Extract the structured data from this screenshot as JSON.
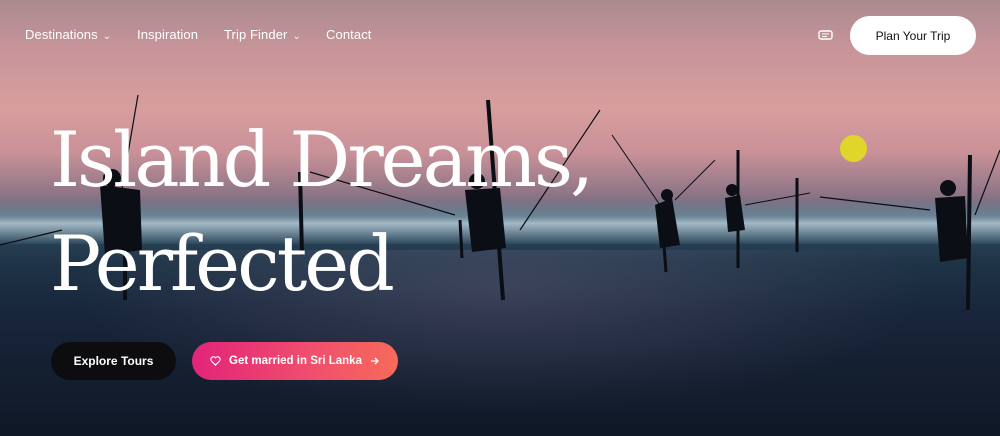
{
  "nav": {
    "items": [
      {
        "label": "Destinations",
        "has_dropdown": true
      },
      {
        "label": "Inspiration",
        "has_dropdown": false
      },
      {
        "label": "Trip Finder",
        "has_dropdown": true
      },
      {
        "label": "Contact",
        "has_dropdown": false
      }
    ],
    "language_icon": "language-switch-icon",
    "cta_label": "Plan Your Trip"
  },
  "hero": {
    "headline_line1": "Island Dreams,",
    "headline_line2": "Perfected",
    "primary_button": "Explore Tours",
    "secondary_button": "Get married in Sri Lanka",
    "secondary_icon": "heart-icon",
    "secondary_arrow": "arrow-right-icon"
  },
  "colors": {
    "cta_bg": "#ffffff",
    "dark_button": "#0d0d0f",
    "gradient_start": "#e2247a",
    "gradient_end": "#f76a5a"
  }
}
